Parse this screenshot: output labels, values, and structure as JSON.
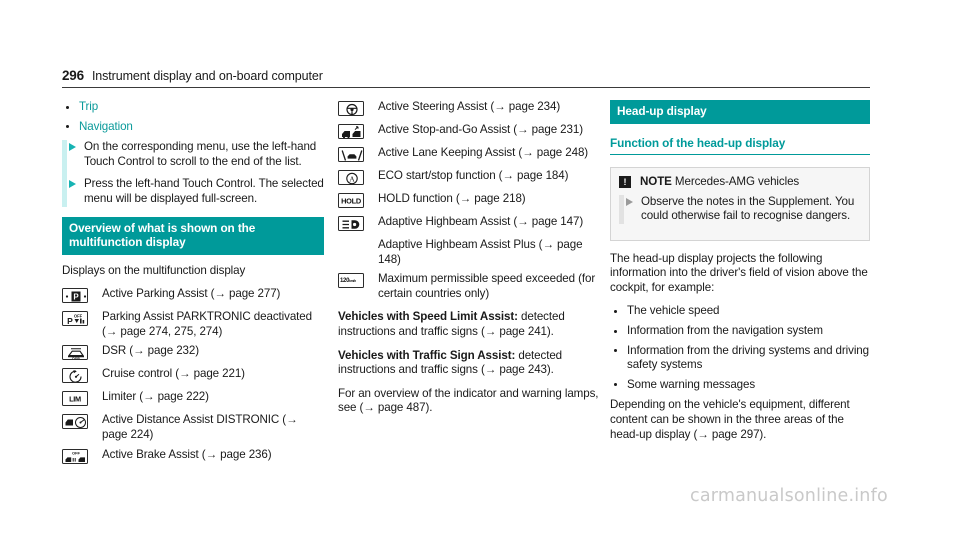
{
  "header": {
    "page_number": "296",
    "title": "Instrument display and on-board computer"
  },
  "left_column": {
    "menu_bullets": [
      {
        "label": "Trip"
      },
      {
        "label": "Navigation"
      }
    ],
    "steps": [
      {
        "text": "On the corresponding menu, use the left-hand Touch Control to scroll to the end of the list."
      },
      {
        "text": "Press the left-hand Touch Control.\nThe selected menu will be displayed full-screen."
      }
    ],
    "section_heading": "Overview of what is shown on the multifunction display",
    "intro": "Displays on the multifunction display",
    "items": [
      {
        "icon": "parking-assist-icon",
        "text": "Active Parking Assist (→ page 277)"
      },
      {
        "icon": "parktronic-deactivated-icon",
        "text": "Parking Assist PARKTRONIC deactivated (→ page 274, 275, 274)"
      },
      {
        "icon": "dsr-icon",
        "text": "DSR (→ page 232)"
      },
      {
        "icon": "cruise-control-icon",
        "text": "Cruise control (→ page 221)"
      },
      {
        "icon": "limiter-icon",
        "text": "Limiter (→ page 222)"
      },
      {
        "icon": "distronic-icon",
        "text": "Active Distance Assist DISTRONIC (→ page 224)"
      },
      {
        "icon": "active-brake-assist-icon",
        "text": "Active Brake Assist (→ page 236)"
      }
    ]
  },
  "middle_column": {
    "items": [
      {
        "icon": "steering-wheel-icon",
        "text": "Active Steering Assist (→ page 234)"
      },
      {
        "icon": "stop-and-go-icon",
        "text": "Active Stop-and-Go Assist (→ page 231)"
      },
      {
        "icon": "lane-keeping-icon",
        "text": "Active Lane Keeping Assist (→ page 248)"
      },
      {
        "icon": "eco-start-stop-icon",
        "text": "ECO start/stop function (→ page 184)"
      },
      {
        "icon": "hold-icon",
        "text": "HOLD function (→ page 218)"
      },
      {
        "icon": "adaptive-highbeam-icon",
        "text": "Adaptive Highbeam Assist (→ page 147)"
      },
      {
        "icon": "none",
        "text": "Adaptive Highbeam Assist Plus (→ page 148)"
      },
      {
        "icon": "speed-limit-sign-icon",
        "text": "Maximum permissible speed exceeded (for certain countries only)"
      }
    ],
    "paragraphs": [
      {
        "bold_lead": "Vehicles with Speed Limit Assist:",
        "rest": " detected instructions and traffic signs (→ page 241)."
      },
      {
        "bold_lead": "Vehicles with Traffic Sign Assist:",
        "rest": " detected instructions and traffic signs (→ page 243)."
      },
      {
        "bold_lead": "",
        "rest": "For an overview of the indicator and warning lamps, see (→ page 487)."
      }
    ]
  },
  "right_column": {
    "section_heading": "Head-up display",
    "sub_heading": "Function of the head-up display",
    "note": {
      "label": "NOTE",
      "title_rest": " Mercedes-AMG vehicles",
      "step": "Observe the notes in the Supplement.\nYou could otherwise fail to recognise dangers."
    },
    "intro": "The head-up display projects the following information into the driver's field of vision above the cockpit, for example:",
    "bullets": [
      {
        "label": "The vehicle speed"
      },
      {
        "label": "Information from the navigation system"
      },
      {
        "label": "Information from the driving systems and driving safety systems"
      },
      {
        "label": "Some warning messages"
      }
    ],
    "outro": "Depending on the vehicle's equipment, different content can be shown in the three areas of the head-up display (→ page 297)."
  },
  "watermark": "carmanualsonline.info",
  "colors": {
    "teal": "#009a9a",
    "teal_link": "#0a9a9a",
    "cyan_bar": "#c9f0f0",
    "note_bg": "#f6f6f6",
    "text": "#1a1a1a"
  }
}
